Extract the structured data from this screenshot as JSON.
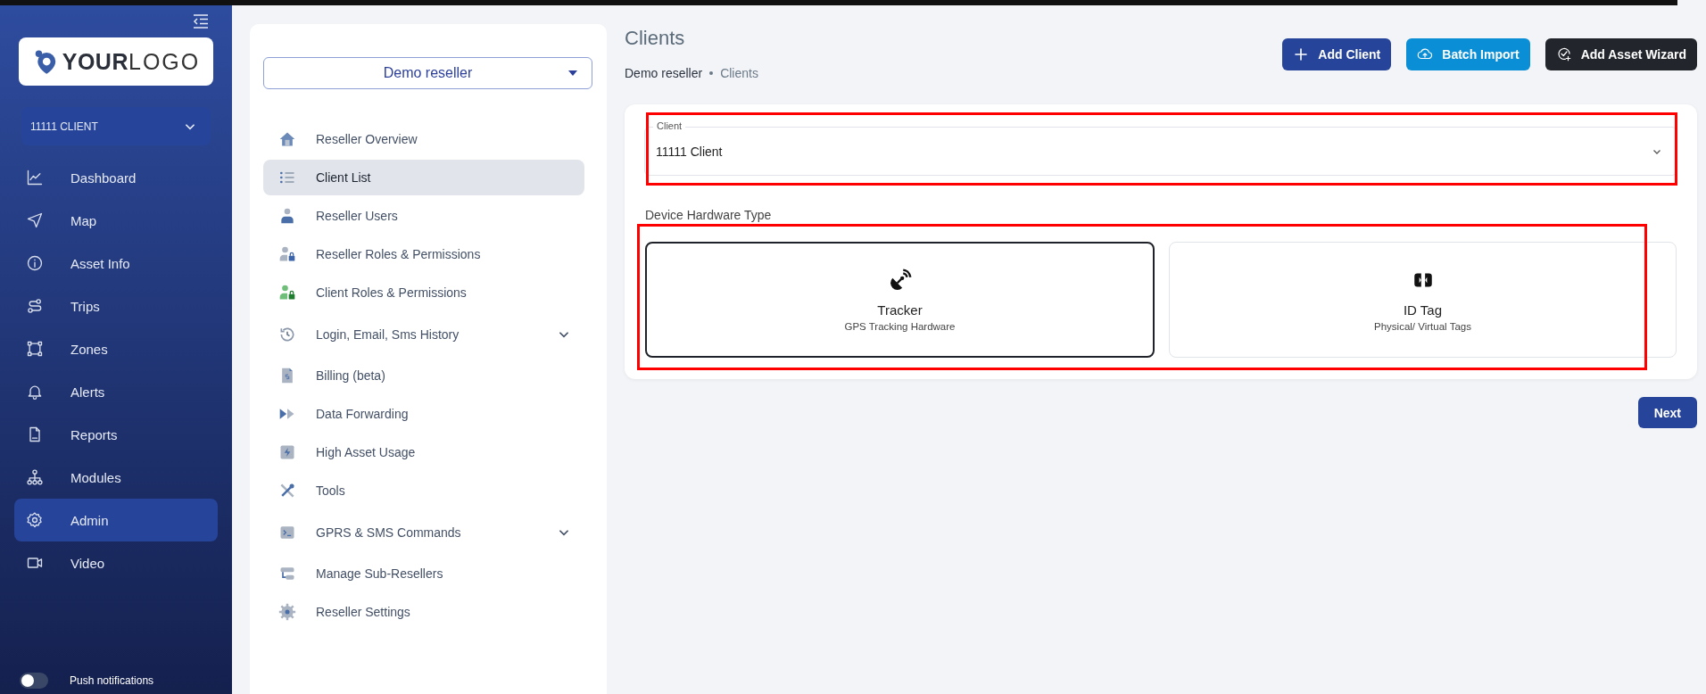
{
  "sidebar": {
    "logo": {
      "bold": "YOUR",
      "light": "LOGO"
    },
    "client_select": {
      "value": "11111 CLIENT"
    },
    "items": [
      {
        "label": "Dashboard",
        "selected": false
      },
      {
        "label": "Map",
        "selected": false
      },
      {
        "label": "Asset Info",
        "selected": false
      },
      {
        "label": "Trips",
        "selected": false
      },
      {
        "label": "Zones",
        "selected": false
      },
      {
        "label": "Alerts",
        "selected": false
      },
      {
        "label": "Reports",
        "selected": false
      },
      {
        "label": "Modules",
        "selected": false
      },
      {
        "label": "Admin",
        "selected": true
      },
      {
        "label": "Video",
        "selected": false
      }
    ],
    "push_notifications": {
      "label": "Push notifications",
      "on": false
    }
  },
  "reseller_panel": {
    "reseller_select": {
      "value": "Demo reseller"
    },
    "items": [
      {
        "label": "Reseller Overview",
        "kind": "link",
        "selected": false
      },
      {
        "label": "Client List",
        "kind": "link",
        "selected": true
      },
      {
        "label": "Reseller Users",
        "kind": "link",
        "selected": false
      },
      {
        "label": "Reseller Roles & Permissions",
        "kind": "link",
        "selected": false
      },
      {
        "label": "Client Roles & Permissions",
        "kind": "link",
        "selected": false
      },
      {
        "label": "Login, Email, Sms History",
        "kind": "group",
        "selected": false
      },
      {
        "label": "Billing (beta)",
        "kind": "link",
        "selected": false
      },
      {
        "label": "Data Forwarding",
        "kind": "link",
        "selected": false
      },
      {
        "label": "High Asset Usage",
        "kind": "link",
        "selected": false
      },
      {
        "label": "Tools",
        "kind": "link",
        "selected": false
      },
      {
        "label": "GPRS & SMS Commands",
        "kind": "group",
        "selected": false
      },
      {
        "label": "Manage Sub-Resellers",
        "kind": "link",
        "selected": false
      },
      {
        "label": "Reseller Settings",
        "kind": "link",
        "selected": false
      }
    ]
  },
  "page": {
    "title": "Clients",
    "breadcrumb": [
      "Demo reseller",
      "Clients"
    ],
    "actions": [
      {
        "label": "Add Client",
        "kind": "primary"
      },
      {
        "label": "Batch Import",
        "kind": "info"
      },
      {
        "label": "Add Asset Wizard",
        "kind": "dark"
      }
    ],
    "client_field": {
      "label": "Client",
      "value": "11111 Client",
      "highlighted": true
    },
    "hardware_label": "Device Hardware Type",
    "hardware_highlighted": true,
    "hardware_types": [
      {
        "title": "Tracker",
        "subtitle": "GPS Tracking Hardware",
        "selected": true
      },
      {
        "title": "ID Tag",
        "subtitle": "Physical/ Virtual Tags",
        "selected": false
      }
    ],
    "next_button": "Next"
  }
}
